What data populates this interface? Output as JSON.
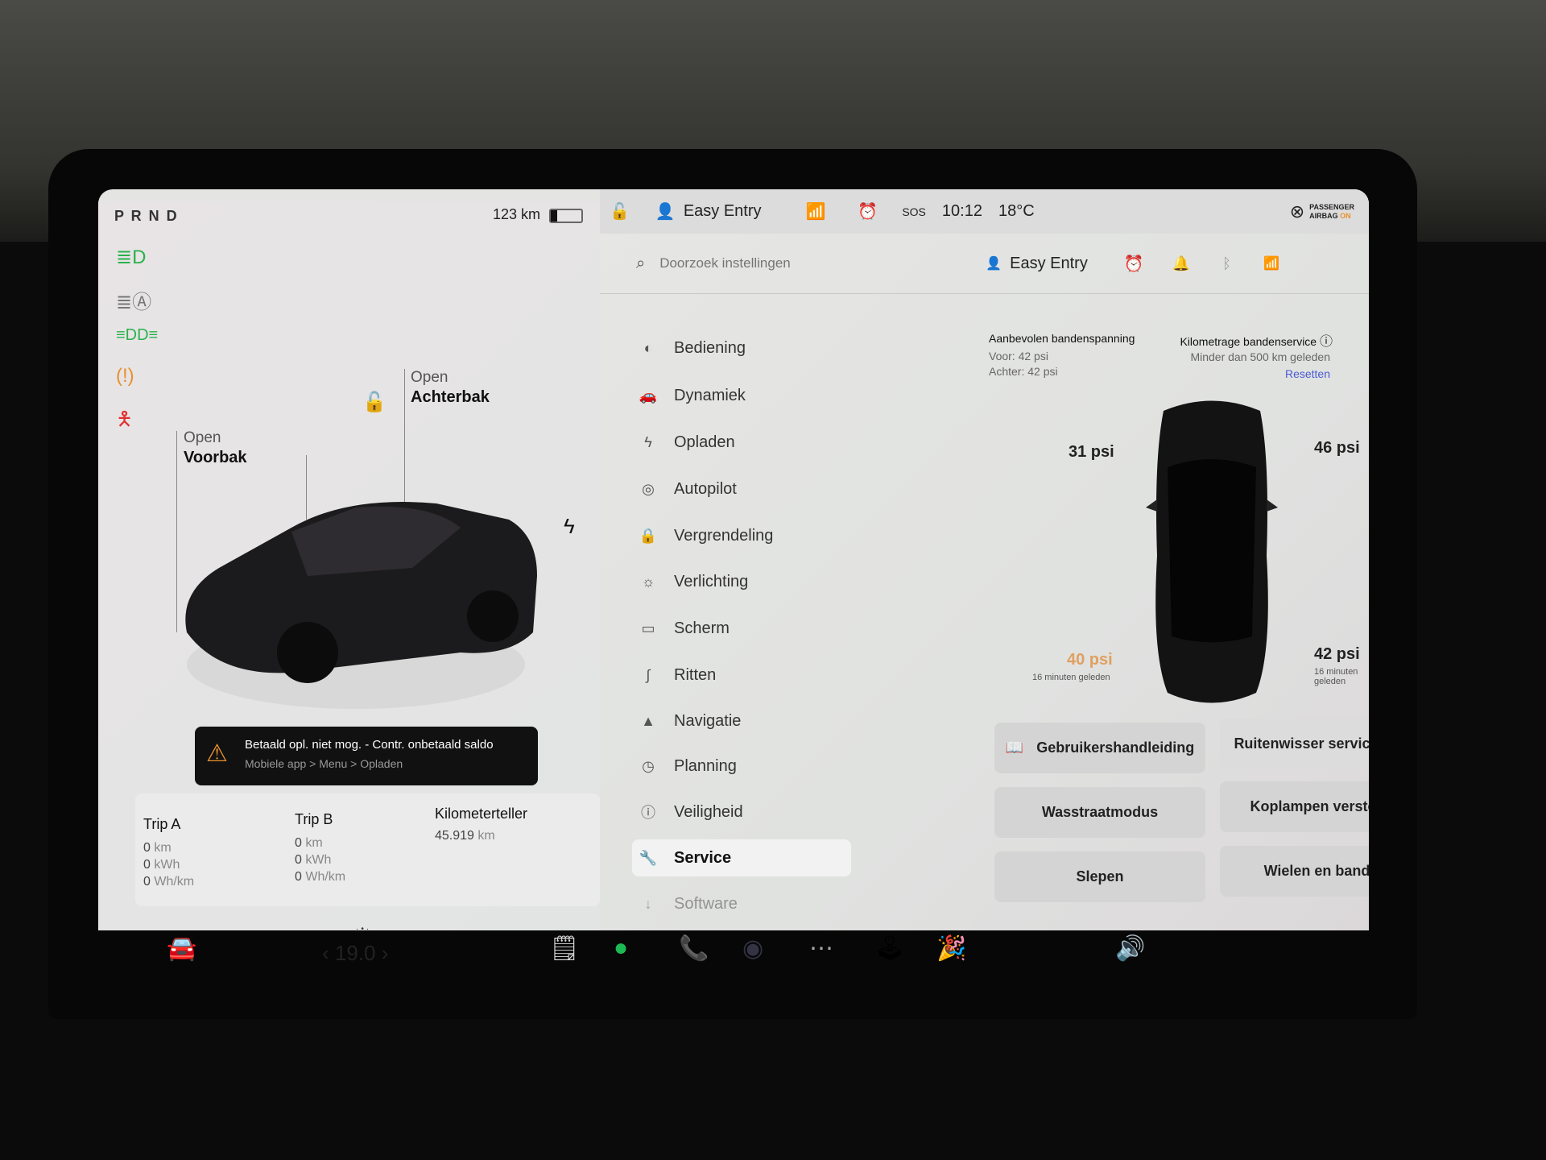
{
  "gear": "P R N D",
  "range": "123 km",
  "battery_percent": 20,
  "indicators": [
    {
      "icon": "low-beam-icon",
      "color": "#2bb24c"
    },
    {
      "icon": "auto-high-beam-icon",
      "color": "#777777"
    },
    {
      "icon": "parking-lights-icon",
      "color": "#2bb24c"
    },
    {
      "icon": "tire-pressure-warning-icon",
      "color": "#e8912d"
    },
    {
      "icon": "seatbelt-warning-icon",
      "color": "#e03030"
    }
  ],
  "car_view": {
    "frunk_label_top": "Open",
    "frunk_label": "Voorbak",
    "trunk_label_top": "Open",
    "trunk_label": "Achterbak"
  },
  "alert": {
    "title": "Betaald opl. niet mog. - Contr. onbetaald saldo",
    "subtitle": "Mobiele app > Menu > Opladen"
  },
  "trips": {
    "trip_a": {
      "title": "Trip A",
      "km": "0",
      "kwh": "0",
      "whkm": "0"
    },
    "trip_b": {
      "title": "Trip B",
      "km": "0",
      "kwh": "0",
      "whkm": "0"
    },
    "odometer": {
      "title": "Kilometerteller",
      "value": "45.919",
      "unit": "km"
    },
    "units": {
      "km": "km",
      "kwh": "kWh",
      "whkm": "Wh/km"
    }
  },
  "status_bar": {
    "profile": "Easy Entry",
    "sos": "SOS",
    "time": "10:12",
    "temperature": "18°C",
    "airbag_line1": "PASSENGER",
    "airbag_line2": "AIRBAG",
    "airbag_state": "ON"
  },
  "search": {
    "placeholder": "Doorzoek instellingen",
    "profile": "Easy Entry"
  },
  "menu": [
    {
      "label": "Bediening",
      "icon": "toggle-icon"
    },
    {
      "label": "Dynamiek",
      "icon": "car-icon"
    },
    {
      "label": "Opladen",
      "icon": "bolt-icon"
    },
    {
      "label": "Autopilot",
      "icon": "steering-wheel-icon"
    },
    {
      "label": "Vergrendeling",
      "icon": "lock-icon"
    },
    {
      "label": "Verlichting",
      "icon": "light-icon"
    },
    {
      "label": "Scherm",
      "icon": "display-icon"
    },
    {
      "label": "Ritten",
      "icon": "trips-icon"
    },
    {
      "label": "Navigatie",
      "icon": "navigation-icon"
    },
    {
      "label": "Planning",
      "icon": "clock-icon"
    },
    {
      "label": "Veiligheid",
      "icon": "safety-icon"
    },
    {
      "label": "Service",
      "icon": "wrench-icon",
      "active": true
    },
    {
      "label": "Software",
      "icon": "download-icon"
    }
  ],
  "service": {
    "recommended_title": "Aanbevolen bandenspanning",
    "front": "Voor: 42 psi",
    "rear": "Achter: 42 psi",
    "mileage_title": "Kilometrage bandenservice",
    "mileage_value": "Minder dan 500 km geleden",
    "reset": "Resetten",
    "tires": {
      "front_left": "31 psi",
      "front_right": "46 psi",
      "rear_left": "40 psi",
      "rear_left_ago": "16 minuten geleden",
      "rear_right": "42 psi",
      "rear_right_ago": "16 minuten geleden"
    },
    "buttons": [
      "Gebruikershandleiding",
      "Ruitenwisser servicestand",
      "Wasstraatmodus",
      "Koplampen verstellen",
      "Slepen",
      "Wielen en banden"
    ]
  },
  "colors": {
    "accent": "#4a5bd0",
    "warning": "#e8912d",
    "alarm": "#e8912d"
  }
}
